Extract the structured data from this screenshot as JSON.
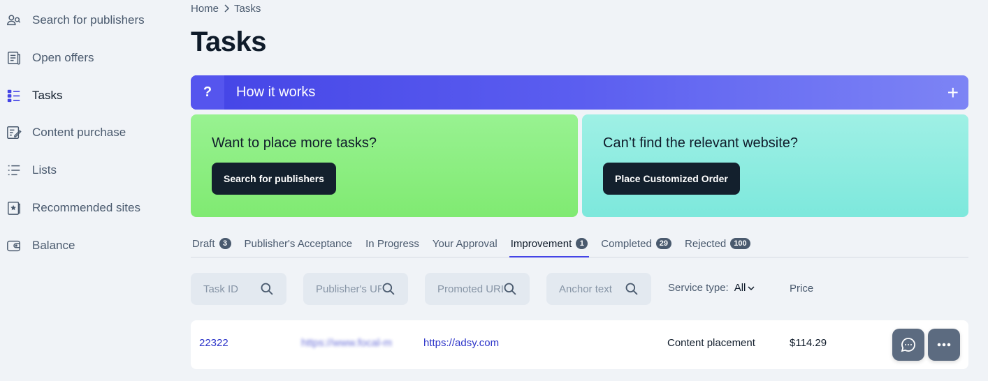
{
  "sidebar": {
    "items": [
      {
        "label": "Search for publishers",
        "icon": "users-search-icon"
      },
      {
        "label": "Open offers",
        "icon": "document-icon"
      },
      {
        "label": "Tasks",
        "icon": "tasks-icon"
      },
      {
        "label": "Content purchase",
        "icon": "edit-document-icon"
      },
      {
        "label": "Lists",
        "icon": "list-icon"
      },
      {
        "label": "Recommended sites",
        "icon": "star-bookmark-icon"
      },
      {
        "label": "Balance",
        "icon": "wallet-icon"
      }
    ],
    "active_index": 2
  },
  "breadcrumb": {
    "home": "Home",
    "current": "Tasks"
  },
  "page_title": "Tasks",
  "how_it_works": {
    "q": "?",
    "title": "How it works",
    "expand": "+"
  },
  "promo": {
    "left": {
      "title": "Want to place more tasks?",
      "button": "Search for publishers"
    },
    "right": {
      "title": "Can’t find the relevant website?",
      "button": "Place Customized Order"
    }
  },
  "tabs": [
    {
      "label": "Draft",
      "count": "3"
    },
    {
      "label": "Publisher's Acceptance",
      "count": null
    },
    {
      "label": "In Progress",
      "count": null
    },
    {
      "label": "Your Approval",
      "count": null
    },
    {
      "label": "Improvement",
      "count": "1"
    },
    {
      "label": "Completed",
      "count": "29"
    },
    {
      "label": "Rejected",
      "count": "100"
    }
  ],
  "active_tab_index": 4,
  "filters": {
    "task_id_placeholder": "Task ID",
    "publisher_placeholder": "Publisher's URL",
    "promoted_placeholder": "Promoted URL",
    "anchor_placeholder": "Anchor text",
    "service_type_label": "Service type:",
    "service_type_value": "All",
    "price_header": "Price"
  },
  "rows": [
    {
      "task_id": "22322",
      "publisher_url": "https://www.focal-m",
      "promoted_url": "https://adsy.com",
      "service": "Content placement",
      "price": "$114.29"
    }
  ],
  "colors": {
    "accent": "#4444e6",
    "dark": "#13202d",
    "green": "#86ec79",
    "teal": "#86eadf"
  }
}
